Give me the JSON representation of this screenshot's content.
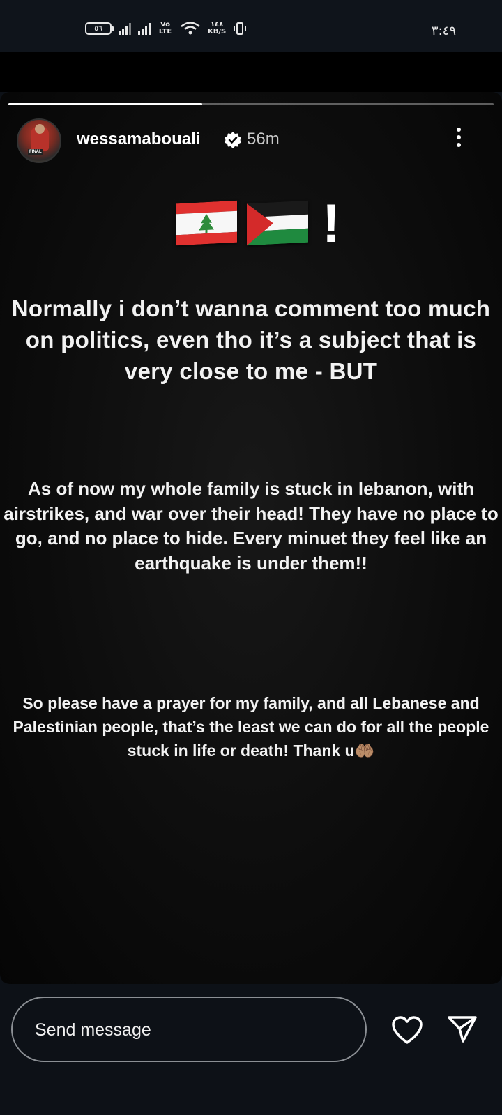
{
  "status_bar": {
    "battery": "٥٦",
    "network_label": "Vo LTE",
    "speed_value": "١٤٨",
    "speed_unit": "KB/S",
    "time": "٣:٤٩"
  },
  "story": {
    "progress": 0.4,
    "username": "wessamabouali",
    "time_ago": "56m",
    "verified_icon": "verified-badge-icon",
    "menu_icon": "more-vertical-icon",
    "flags": [
      "lebanon-flag",
      "palestine-flag"
    ],
    "flag_suffix": "!",
    "paragraph1": "Normally i don’t wanna comment too much on politics, even tho it’s a subject that is very close to me - BUT",
    "paragraph2": "As of now my whole family is stuck in lebanon, with airstrikes, and war over their head! They have no place to go, and no place to hide. Every minuet they feel like an earthquake is under them!!",
    "paragraph3": "So please have a prayer for my family, and all Lebanese and Palestinian people, that’s the least we can do for all the people stuck in life or death! Thank u",
    "paragraph3_emoji": "🤲🏽"
  },
  "bottom_bar": {
    "message_placeholder": "Send message",
    "like_icon": "heart-icon",
    "share_icon": "send-icon"
  },
  "colors": {
    "background": "#0d1117",
    "text": "#f2f2f2",
    "lebanon_red": "#e0312f",
    "lebanon_green": "#2e8b3a",
    "palestine_green": "#1f8a3f",
    "palestine_red": "#d42a2a"
  }
}
